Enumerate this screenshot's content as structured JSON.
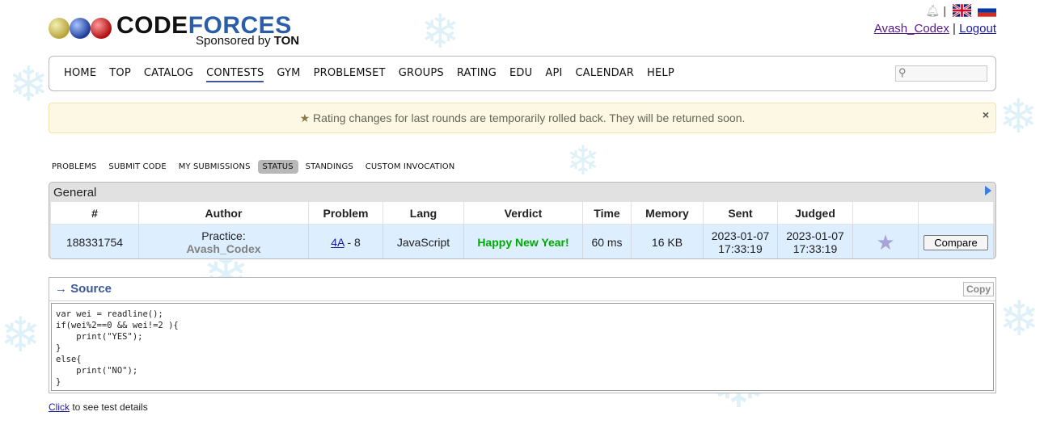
{
  "header": {
    "logo_word_part1": "CODE",
    "logo_word_part2": "FORCES",
    "sponsor_text": "Sponsored by",
    "sponsor_name": "TON",
    "username": "Avash_Codex",
    "separator": "|",
    "logout": "Logout"
  },
  "nav": {
    "items": [
      "HOME",
      "TOP",
      "CATALOG",
      "CONTESTS",
      "GYM",
      "PROBLEMSET",
      "GROUPS",
      "RATING",
      "EDU",
      "API",
      "CALENDAR",
      "HELP"
    ],
    "active": "CONTESTS",
    "search_value": ""
  },
  "banner": {
    "text": "Rating changes for last rounds are temporarily rolled back. They will be returned soon.",
    "close": "×"
  },
  "tabs": {
    "items": [
      "PROBLEMS",
      "SUBMIT CODE",
      "MY SUBMISSIONS",
      "STATUS",
      "STANDINGS",
      "CUSTOM INVOCATION"
    ],
    "active": "STATUS"
  },
  "status": {
    "title": "General",
    "headers": [
      "#",
      "Author",
      "Problem",
      "Lang",
      "Verdict",
      "Time",
      "Memory",
      "Sent",
      "Judged",
      "",
      ""
    ],
    "row": {
      "id": "188331754",
      "author_prefix": "Practice:",
      "author_name": "Avash_Codex",
      "problem_link": "4A",
      "problem_rest": " - 8",
      "lang": "JavaScript",
      "verdict": "Happy New Year!",
      "time": "60 ms",
      "memory": "16 KB",
      "sent_date": "2023-01-07",
      "sent_time": "17:33:19",
      "judged_date": "2023-01-07",
      "judged_time": "17:33:19",
      "compare": "Compare"
    }
  },
  "source": {
    "title": "→ Source",
    "copy": "Copy",
    "lines": [
      "var wei = readline();",
      "if(wei%2==0 && wei!=2 ){",
      "    print(\"YES\");",
      "}",
      "else{",
      "    print(\"NO\");",
      "}"
    ]
  },
  "footer": {
    "click_link": "Click",
    "click_rest": " to see test details"
  },
  "colors": {
    "accent": "#3b5998",
    "verdict_ok": "#00aa00",
    "banner_bg": "#fcf8e3",
    "row_bg": "#ddeeff"
  },
  "icons": [
    "bell-icon",
    "uk-flag-icon",
    "russia-flag-icon",
    "search-icon",
    "star-icon",
    "close-icon",
    "arrow-right-icon"
  ]
}
